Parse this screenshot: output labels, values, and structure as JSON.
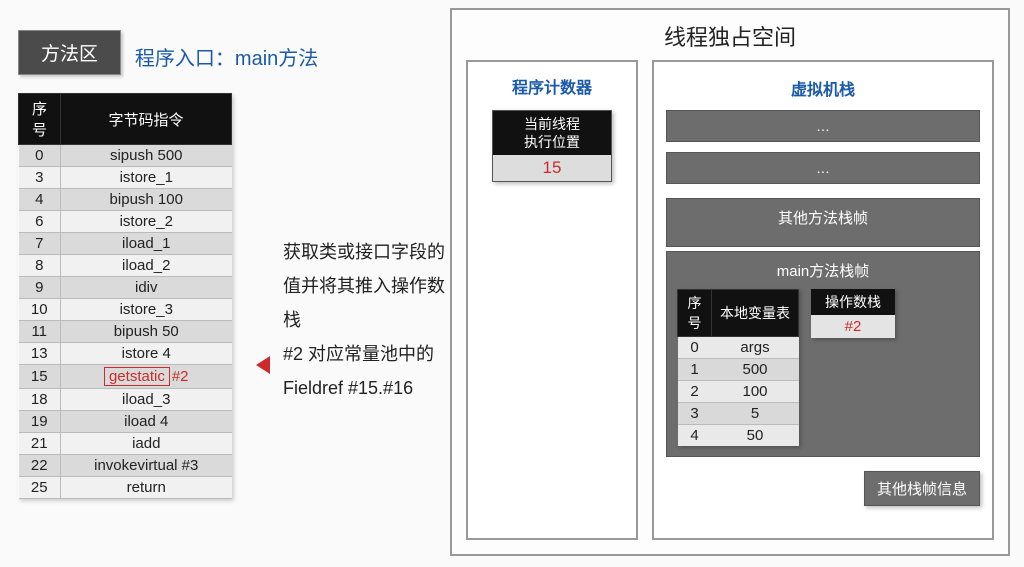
{
  "methodAreaLabel": "方法区",
  "entryLabel": "程序入口：main方法",
  "bytecodeHeaders": {
    "idx": "序号",
    "instr": "字节码指令"
  },
  "bytecodeRows": [
    {
      "idx": "0",
      "instr": "sipush 500"
    },
    {
      "idx": "3",
      "instr": "istore_1"
    },
    {
      "idx": "4",
      "instr": "bipush 100"
    },
    {
      "idx": "6",
      "instr": "istore_2"
    },
    {
      "idx": "7",
      "instr": "iload_1"
    },
    {
      "idx": "8",
      "instr": "iload_2"
    },
    {
      "idx": "9",
      "instr": "idiv"
    },
    {
      "idx": "10",
      "instr": "istore_3"
    },
    {
      "idx": "11",
      "instr": "bipush 50"
    },
    {
      "idx": "13",
      "instr": "istore 4"
    },
    {
      "idx": "15",
      "instr_hl": "getstatic",
      "instr_after": "#2",
      "highlight": true
    },
    {
      "idx": "18",
      "instr": "iload_3"
    },
    {
      "idx": "19",
      "instr": "iload 4"
    },
    {
      "idx": "21",
      "instr": "iadd"
    },
    {
      "idx": "22",
      "instr": "invokevirtual #3"
    },
    {
      "idx": "25",
      "instr": "return"
    }
  ],
  "explain": {
    "line1": "获取类或接口字段的",
    "line2": "值并将其推入操作数",
    "line3": "栈",
    "line4": "#2 对应常量池中的",
    "line5": "Fieldref   #15.#16"
  },
  "threadTitle": "线程独占空间",
  "pc": {
    "title": "程序计数器",
    "head": "当前线程\n执行位置",
    "value": "15"
  },
  "stack": {
    "title": "虚拟机栈",
    "ellipsis": "…",
    "otherFrameTitle": "其他方法栈帧",
    "mainFrameTitle": "main方法栈帧",
    "lvHeaders": {
      "idx": "序号",
      "name": "本地变量表"
    },
    "lvRows": [
      {
        "idx": "0",
        "val": "args"
      },
      {
        "idx": "1",
        "val": "500"
      },
      {
        "idx": "2",
        "val": "100"
      },
      {
        "idx": "3",
        "val": "5"
      },
      {
        "idx": "4",
        "val": "50"
      }
    ],
    "opHeader": "操作数栈",
    "opRows": [
      "#2"
    ],
    "otherInfo": "其他栈帧信息"
  }
}
